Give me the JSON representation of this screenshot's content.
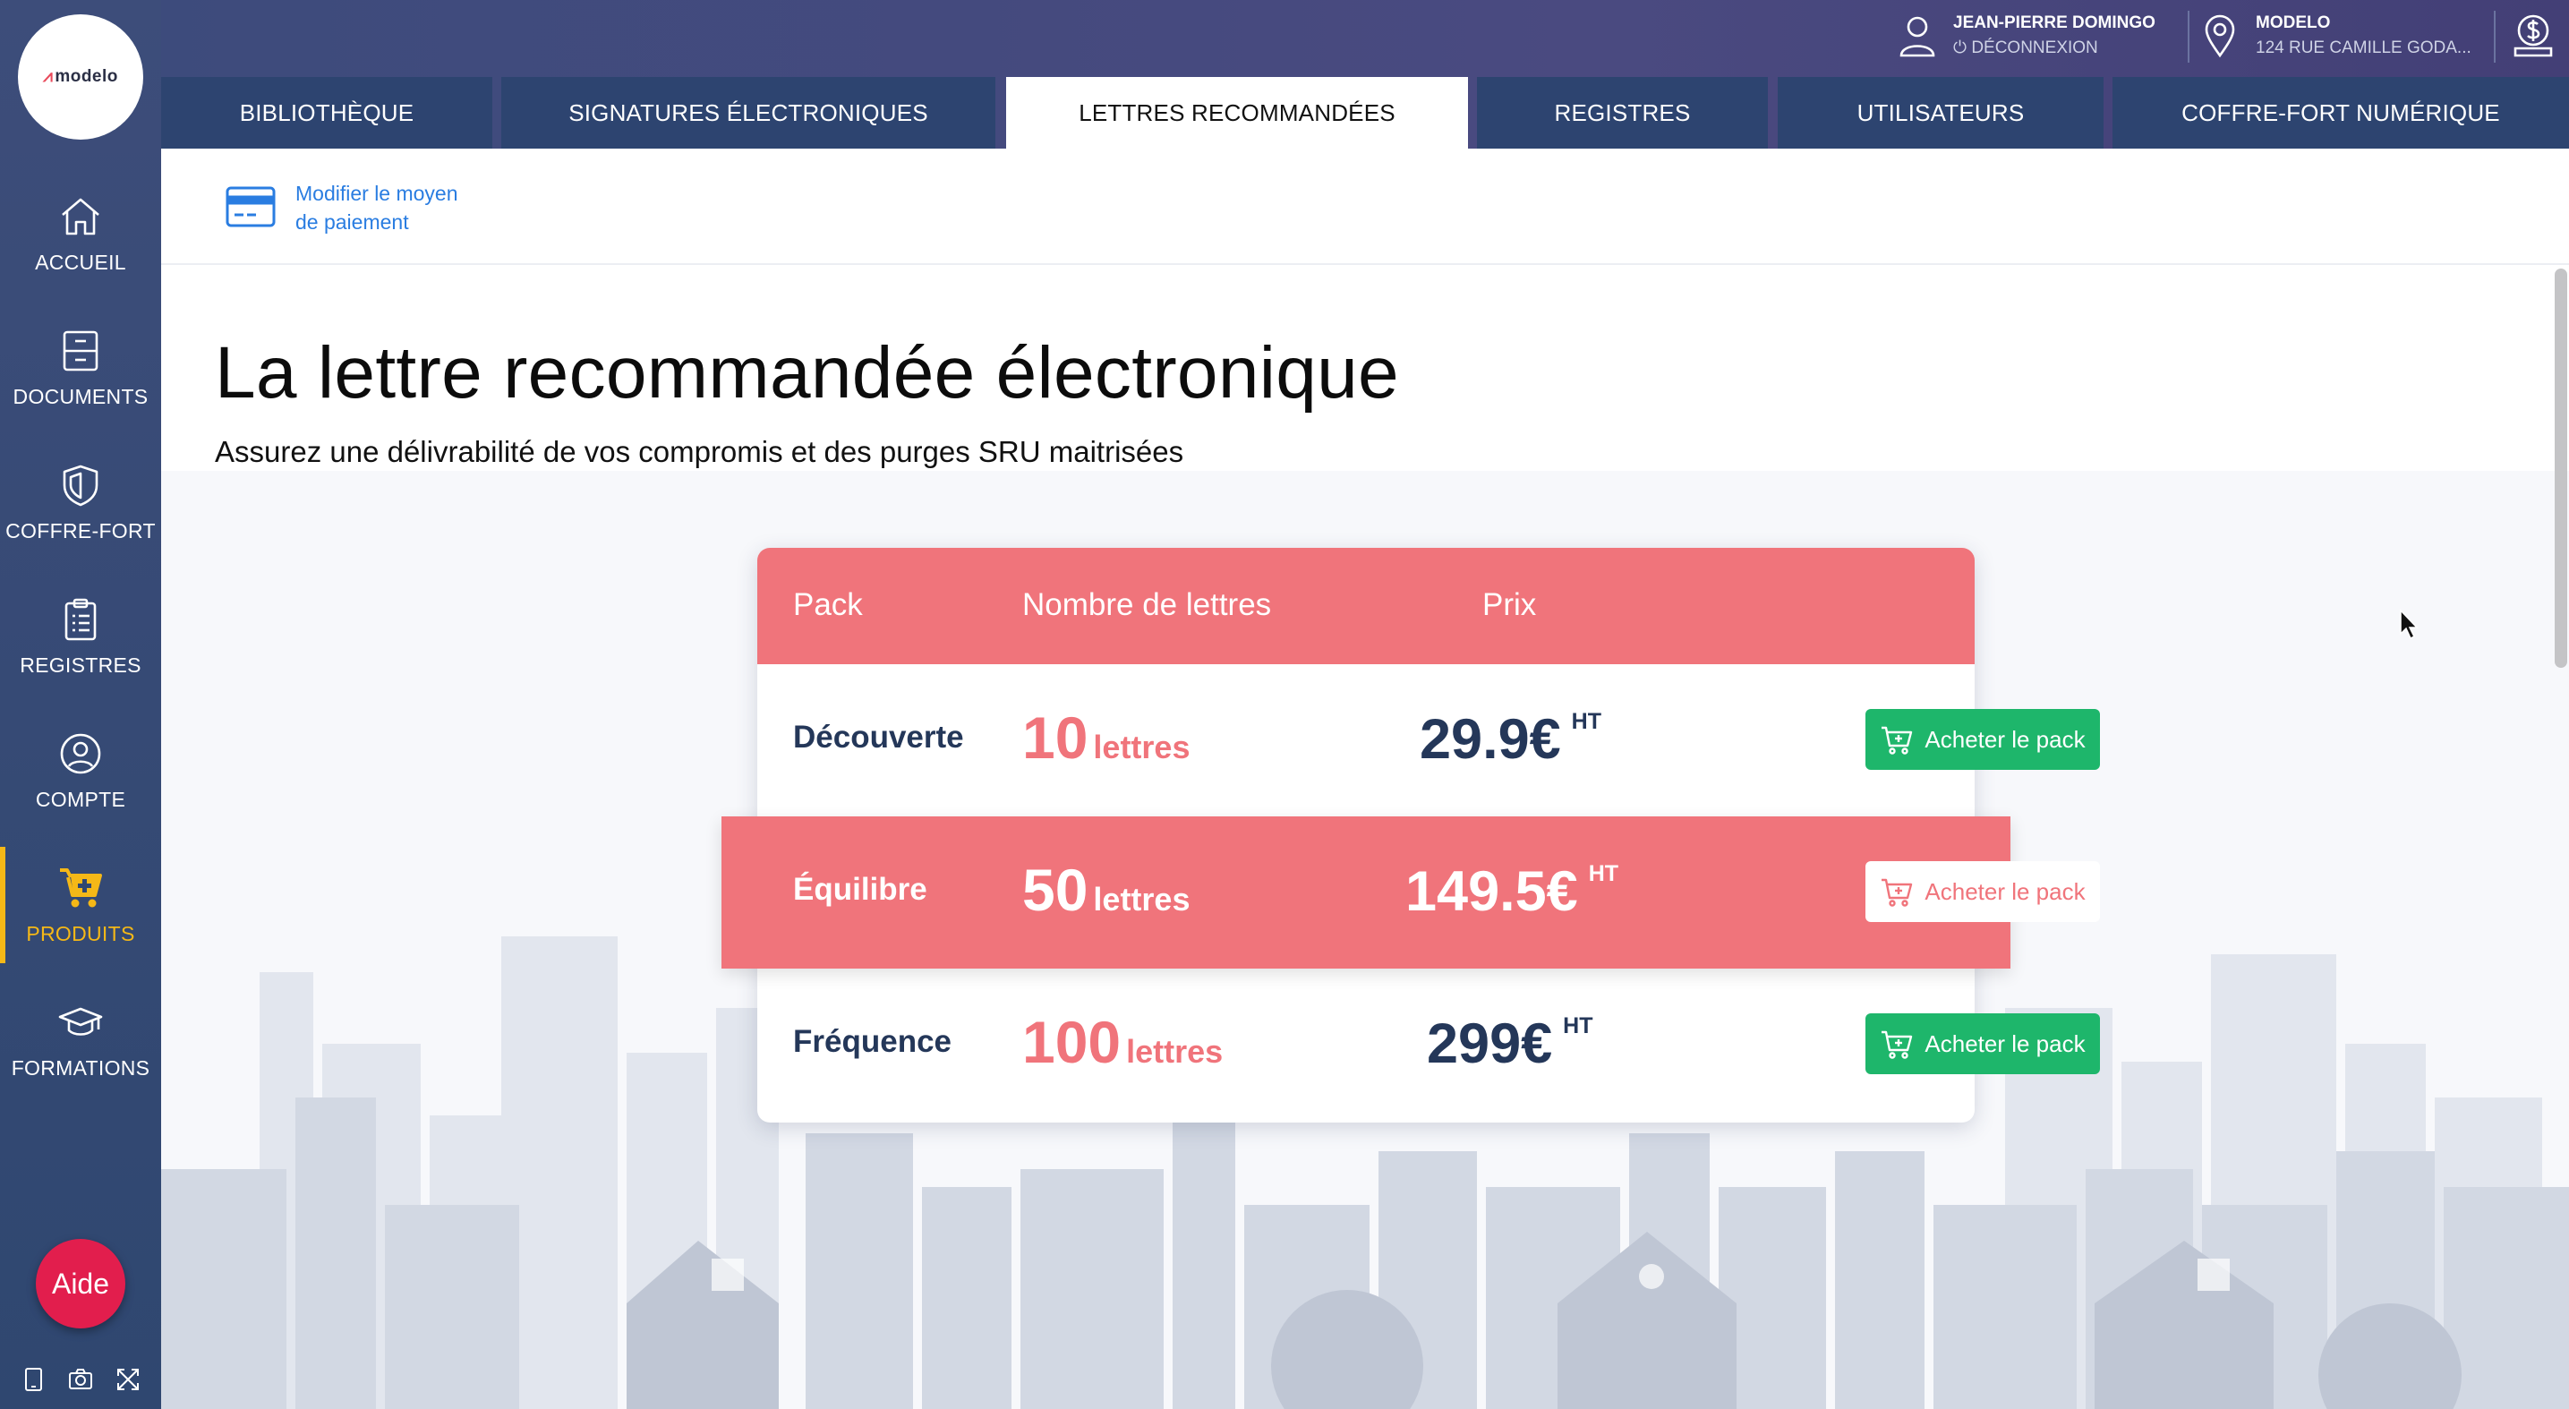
{
  "brand": {
    "logo_text": "modelo",
    "accent": "#e94b5c"
  },
  "sidebar": {
    "items": [
      {
        "label": "ACCUEIL",
        "icon": "home-icon",
        "active": false
      },
      {
        "label": "DOCUMENTS",
        "icon": "file-cabinet-icon",
        "active": false
      },
      {
        "label": "COFFRE-FORT",
        "icon": "shield-icon",
        "active": false
      },
      {
        "label": "REGISTRES",
        "icon": "clipboard-list-icon",
        "active": false
      },
      {
        "label": "COMPTE",
        "icon": "user-circle-icon",
        "active": false
      },
      {
        "label": "PRODUITS",
        "icon": "cart-plus-icon",
        "active": true
      },
      {
        "label": "FORMATIONS",
        "icon": "graduation-cap-icon",
        "active": false
      }
    ],
    "help_label": "Aide",
    "tools": [
      "tablet-icon",
      "camera-icon",
      "expand-icon"
    ],
    "active_color": "#f5b817"
  },
  "header": {
    "user_name": "JEAN-PIERRE DOMINGO",
    "logout_label": "DÉCONNEXION",
    "agency_name": "MODELO",
    "agency_address": "124 RUE CAMILLE GODA..."
  },
  "tabs": [
    {
      "label": "BIBLIOTHÈQUE",
      "active": false
    },
    {
      "label": "SIGNATURES ÉLECTRONIQUES",
      "active": false
    },
    {
      "label": "LETTRES RECOMMANDÉES",
      "active": true
    },
    {
      "label": "REGISTRES",
      "active": false
    },
    {
      "label": "UTILISATEURS",
      "active": false
    },
    {
      "label": "COFFRE-FORT NUMÉRIQUE",
      "active": false
    }
  ],
  "payment": {
    "line1": "Modifier le moyen",
    "line2": "de paiement"
  },
  "main": {
    "title": "La lettre recommandée électronique",
    "subtitle": "Assurez une délivrabilité de vos compromis et des purges SRU maitrisées"
  },
  "pricing": {
    "headers": {
      "pack": "Pack",
      "count": "Nombre de lettres",
      "price": "Prix"
    },
    "rows": [
      {
        "pack": "Découverte",
        "count": "10",
        "unit": "lettres",
        "price": "29.9€",
        "tax": "HT",
        "button": "Acheter le pack",
        "highlight": false
      },
      {
        "pack": "Équilibre",
        "count": "50",
        "unit": "lettres",
        "price": "149.5€",
        "tax": "HT",
        "button": "Acheter le pack",
        "highlight": true
      },
      {
        "pack": "Fréquence",
        "count": "100",
        "unit": "lettres",
        "price": "299€",
        "tax": "HT",
        "button": "Acheter le pack",
        "highlight": false
      }
    ],
    "colors": {
      "header": "#f0747b",
      "button": "#1eb66b",
      "text": "#243759"
    }
  }
}
